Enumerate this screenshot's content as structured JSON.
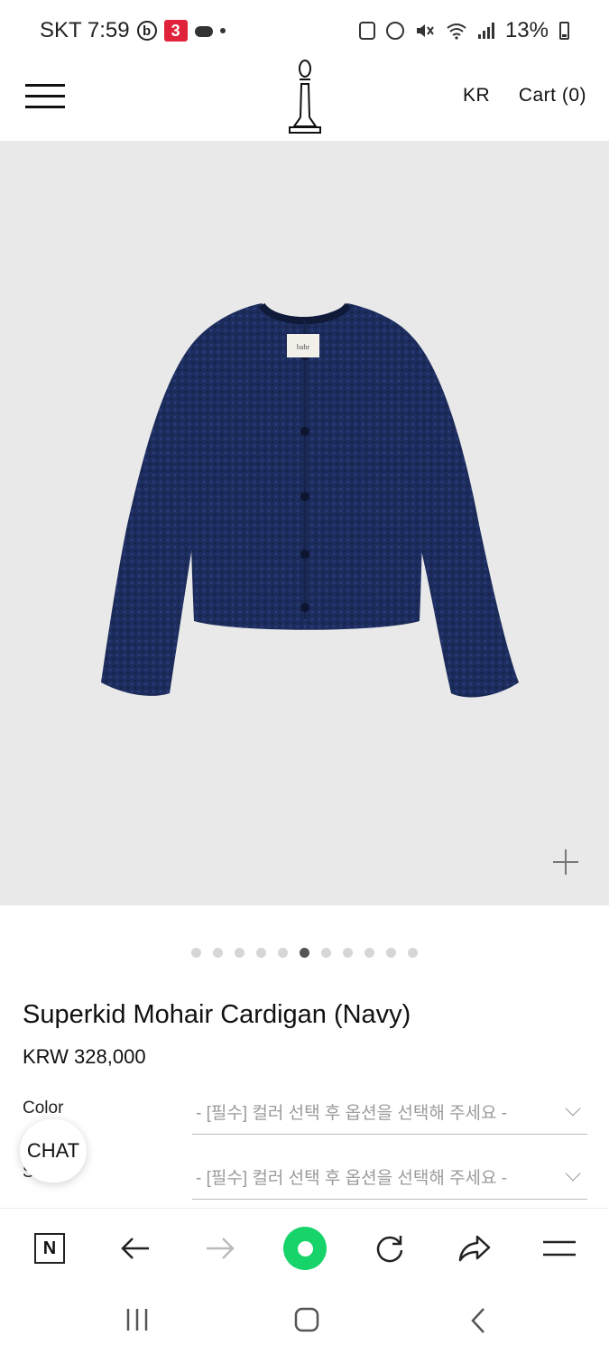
{
  "status_bar": {
    "carrier_time": "SKT 7:59",
    "battery": "13%",
    "left_icons": [
      "b-app-icon",
      "3-app-icon",
      "cloud-icon",
      "dot-icon"
    ],
    "right_icons": [
      "recycle-icon",
      "alarm-icon",
      "mute-icon",
      "wifi-icon",
      "signal-icon",
      "battery-icon"
    ]
  },
  "header": {
    "menu_icon": "hamburger-icon",
    "logo_icon": "bishop-chess-logo",
    "language": "KR",
    "cart": "Cart (0)"
  },
  "gallery": {
    "image_alt": "navy cardigan photo",
    "label_text": "bahr",
    "zoom_icon": "plus-icon",
    "slide_count": 11,
    "active_slide": 6
  },
  "product": {
    "title": "Superkid Mohair Cardigan (Navy)",
    "price": "KRW 328,000"
  },
  "options": [
    {
      "label": "Color",
      "placeholder": "- [필수] 컬러 선택 후 옵션을 선택해 주세요 -"
    },
    {
      "label": "Size",
      "placeholder": "- [필수] 컬러 선택 후 옵션을 선택해 주세요 -"
    }
  ],
  "chat": {
    "label": "CHAT"
  },
  "browser_toolbar": {
    "items": [
      "naver-n-icon",
      "back-arrow-icon",
      "forward-arrow-icon",
      "green-home-icon",
      "refresh-icon",
      "share-icon",
      "menu-icon"
    ],
    "n_label": "N"
  },
  "android_nav": [
    "recent-apps-icon",
    "home-icon",
    "back-icon"
  ],
  "colors": {
    "image_bg": "#e9e9e9",
    "accent_green": "#16d36a",
    "cardigan_navy": "#1c2c5c"
  }
}
